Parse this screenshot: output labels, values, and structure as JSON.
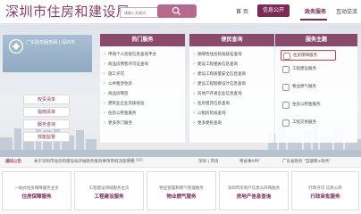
{
  "header": {
    "title": "深圳市住房和建设局",
    "search_placeholder": "请输入关键词",
    "nav": {
      "home": "首 页",
      "news": "信息公开",
      "service": "政务服务",
      "interact": "互动交流"
    }
  },
  "left": {
    "logo_text": "广东政务服务网 | 深圳市",
    "buttons": [
      "权责清单",
      "指南清单",
      "服务咨询",
      "效能监督"
    ]
  },
  "panels": [
    {
      "title": "热门服务",
      "items": [
        "申请个人房屋信息查询平台",
        "商品房预售许可证查询",
        "施工许可",
        "公共租赁住房",
        "商品房网签",
        "建筑业企业资质核准",
        "住房公积金服务",
        "更多热门服务"
      ]
    },
    {
      "title": "便民查询",
      "items": [
        "保障性住房轮候排名查询",
        "建设工程相关信息查询",
        "建设工程质量安全信息查询",
        "建设工程勘察设计信息查询",
        "房地产开发企业信息查询",
        "住房租赁信息查询",
        "公租房轮候查询",
        "更多便民查询"
      ]
    },
    {
      "title": "服务主题",
      "items": [
        "住房保障服务",
        "工程建设服务",
        "物业燃气服务",
        "住房公积金服务",
        "工程交易服务"
      ]
    }
  ],
  "ticker": {
    "label": "通知公告",
    "text": "关于深圳市住房和建设局开展政务服务事项审批流程优化",
    "date": "[06-09]",
    "right_items": [
      "深圳 | 市场",
      "粤省事APP",
      "广东省政务 \"互联网+政务\""
    ]
  },
  "cards": [
    {
      "sub": "一站式住房保障服务主页",
      "main": "住房保障服务"
    },
    {
      "sub": "工程建设领域服务主页",
      "main": "工程建设服务"
    },
    {
      "sub": "物业管理和燃气管理服务",
      "main": "物业燃气服务"
    },
    {
      "sub": "深圳市房地产信息公开和服务",
      "main": "房地产信息查询"
    },
    {
      "sub": "行政许可 信息公开",
      "main": "行政审批服务"
    }
  ],
  "colors": {
    "brand": "#7b2a55",
    "panel_head": "#8a4a6c",
    "highlight": "#e23a3a"
  }
}
